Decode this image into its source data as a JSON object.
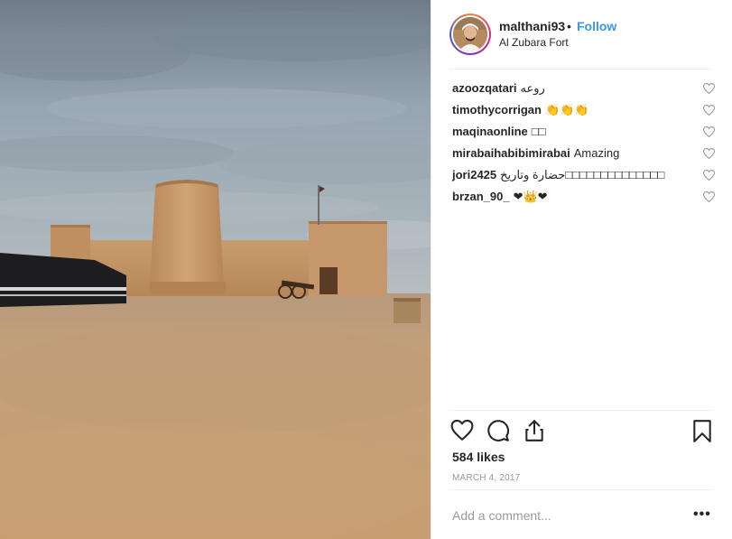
{
  "post": {
    "username": "malthani93",
    "separator": "•",
    "follow_label": "Follow",
    "location": "Al Zubara Fort"
  },
  "comments": [
    {
      "user": "azoozqatari",
      "text": "روعه"
    },
    {
      "user": "timothycorrigan",
      "text": "👏👏👏"
    },
    {
      "user": "maqinaonline",
      "text": "□□"
    },
    {
      "user": "mirabaihabibimirabai",
      "text": "Amazing"
    },
    {
      "user": "jori2425",
      "text": "حضارة وتاريخ□□□□□□□□□□□□□□"
    },
    {
      "user": "brzan_90_",
      "text": "❤👑❤"
    }
  ],
  "actions": {
    "like_icon": "heart-icon",
    "comment_icon": "comment-bubble-icon",
    "share_icon": "share-icon",
    "save_icon": "bookmark-icon"
  },
  "likes": "584 likes",
  "date": "MARCH 4, 2017",
  "add_comment_placeholder": "Add a comment...",
  "more_label": "•••",
  "colors": {
    "link_blue": "#3897f0",
    "text_primary": "#262626",
    "text_secondary": "#999999",
    "divider": "#efefef",
    "sky": "#8a99a6",
    "sand": "#c9a27a",
    "fort": "#c8986a"
  }
}
